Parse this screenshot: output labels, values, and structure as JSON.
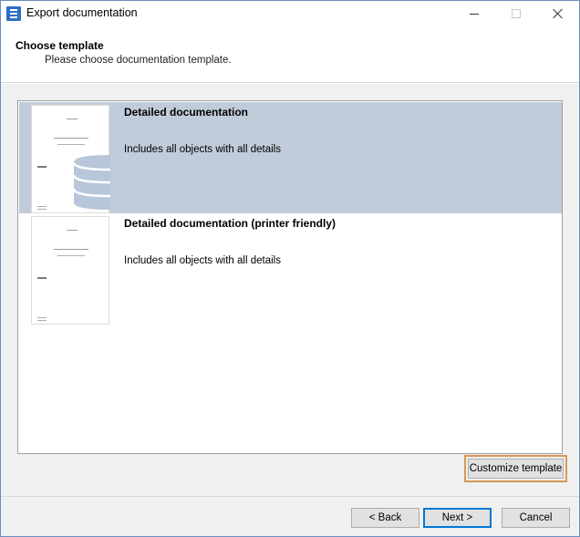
{
  "window": {
    "title": "Export documentation"
  },
  "header": {
    "title": "Choose template",
    "subtitle": "Please choose documentation template."
  },
  "templates": [
    {
      "name": "Detailed documentation",
      "description": "Includes all objects with all details",
      "selected": true
    },
    {
      "name": "Detailed documentation (printer friendly)",
      "description": "Includes all objects with all details",
      "selected": false
    }
  ],
  "buttons": {
    "customize": "Customize template",
    "back": "< Back",
    "next": "Next >",
    "cancel": "Cancel"
  },
  "colors": {
    "selection": "#c0ccd9",
    "highlight_border": "#d29a57",
    "default_button_border": "#0078d7",
    "thumbnail_graphic": "#b7c6da"
  }
}
